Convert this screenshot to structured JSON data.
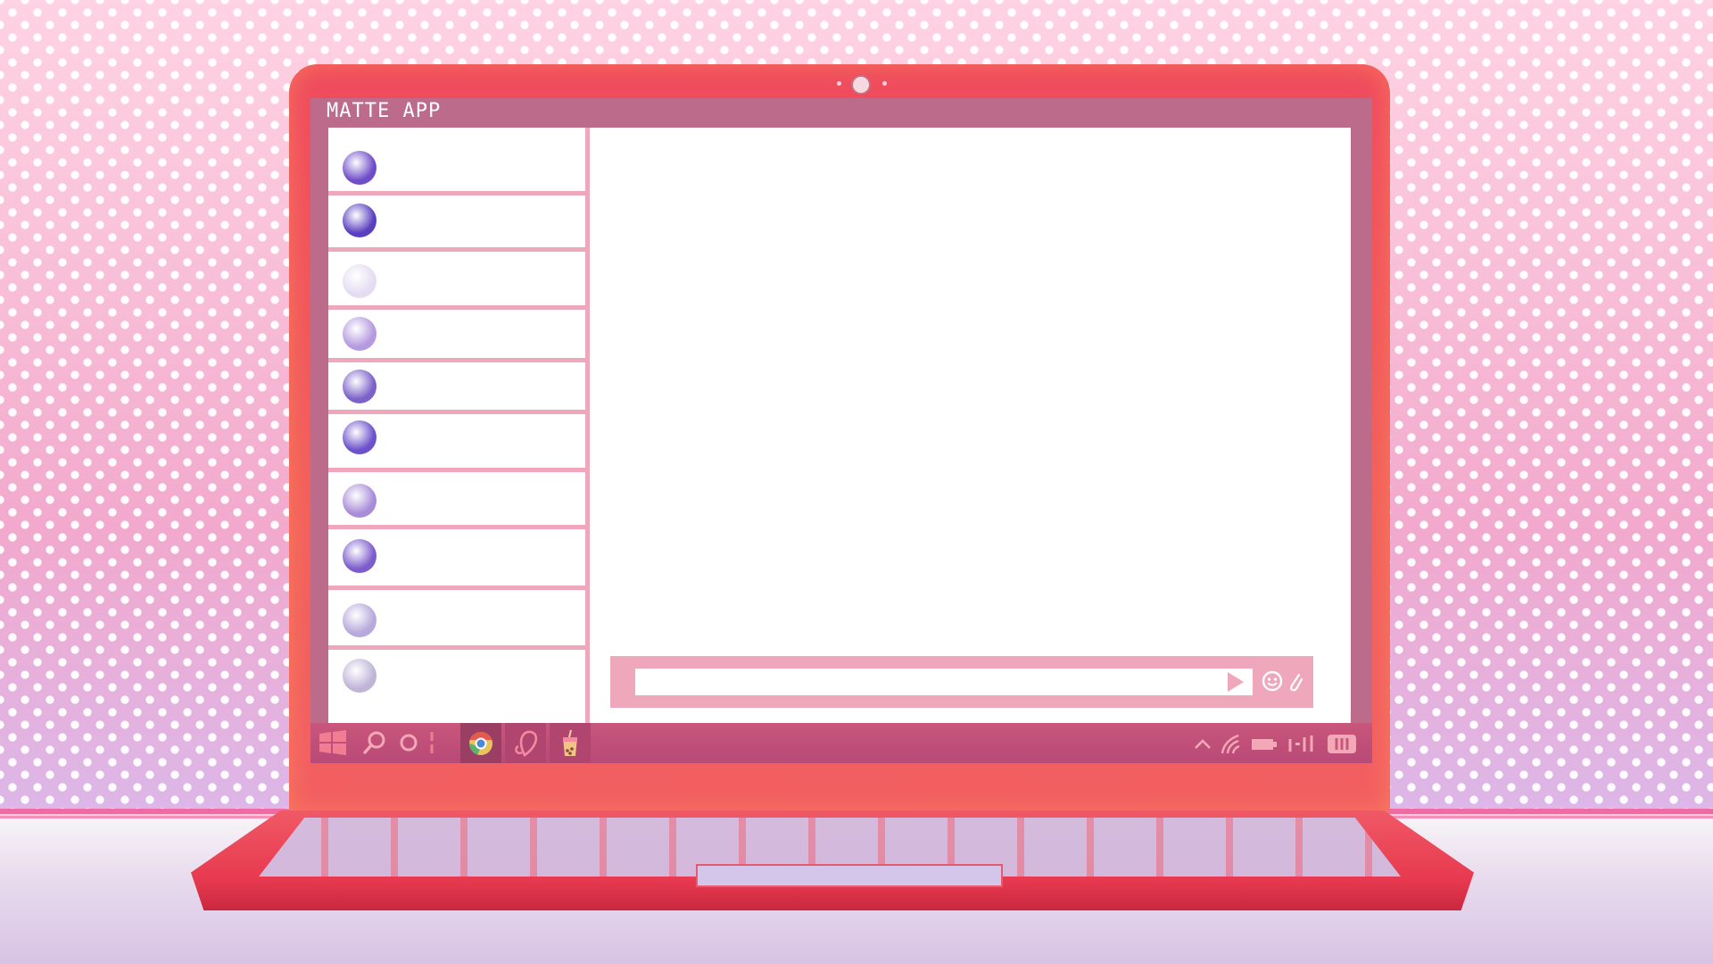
{
  "window": {
    "title": "MATTE APP"
  },
  "contacts": [
    {
      "avatar_color": "#6f4dc8"
    },
    {
      "avatar_color": "#5a3fbf"
    },
    {
      "avatar_color": "#e4ddf2"
    },
    {
      "avatar_color": "#b69ae0"
    },
    {
      "avatar_color": "#7b62c9"
    },
    {
      "avatar_color": "#6c52cb"
    },
    {
      "avatar_color": "#a98cd8"
    },
    {
      "avatar_color": "#7d5ccc"
    },
    {
      "avatar_color": "#b7a9db"
    },
    {
      "avatar_color": "#c0b5d8"
    }
  ],
  "composer": {
    "input_value": "",
    "input_placeholder": ""
  },
  "taskbar": {
    "icons": [
      "windows-start-icon",
      "search-icon",
      "cortana-circle-icon",
      "chrome-icon",
      "heart-app-icon",
      "bubble-tea-icon"
    ],
    "tray": [
      "chevron-up-icon",
      "wifi-icon",
      "battery-icon",
      "volume-icon",
      "notification-icon"
    ]
  },
  "colors": {
    "accent": "#efa7bb",
    "frame": "#bd6b8a",
    "laptop": "#ef4b5e",
    "taskbar": "#c9567b"
  }
}
